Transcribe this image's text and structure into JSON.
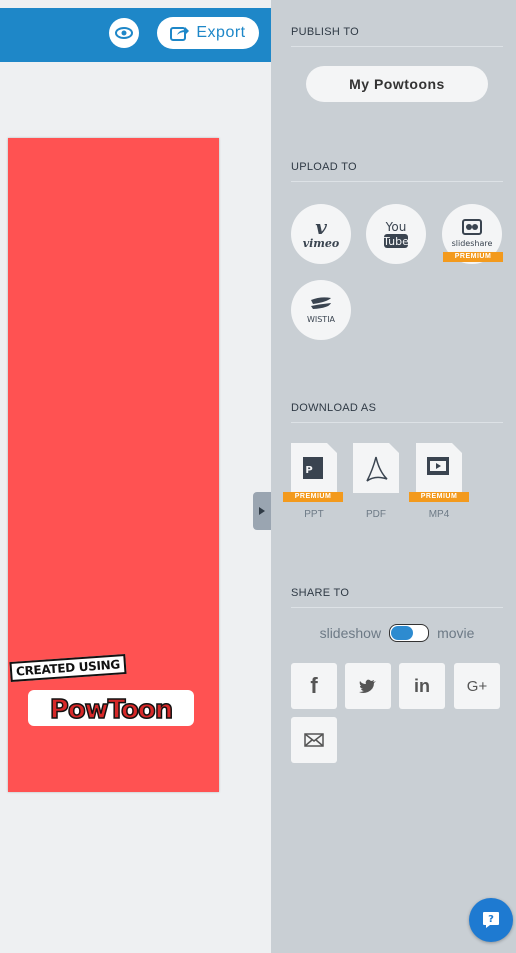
{
  "header": {
    "export_label": "Export"
  },
  "slide": {
    "background_color": "#ff5252",
    "watermark": {
      "tag_text": "CREATED USING",
      "logo_text": "PowToon"
    }
  },
  "panel": {
    "publish": {
      "title": "PUBLISH TO",
      "button_label": "My Powtoons"
    },
    "upload": {
      "title": "UPLOAD TO",
      "services": [
        {
          "name": "vimeo",
          "icon": "vimeo-icon",
          "text": "vimeo"
        },
        {
          "name": "youtube",
          "icon": "youtube-icon",
          "text_top": "You",
          "text_bottom": "Tube"
        },
        {
          "name": "slideshare",
          "icon": "slideshare-icon",
          "text": "slideshare",
          "badge": "PREMIUM"
        },
        {
          "name": "wistia",
          "icon": "wistia-icon",
          "text": "WISTIA"
        }
      ]
    },
    "download": {
      "title": "DOWNLOAD AS",
      "formats": [
        {
          "label": "PPT",
          "badge": "PREMIUM",
          "icon": "ppt-file-icon"
        },
        {
          "label": "PDF",
          "icon": "pdf-file-icon"
        },
        {
          "label": "MP4",
          "badge": "PREMIUM",
          "icon": "mp4-file-icon"
        }
      ]
    },
    "share": {
      "title": "SHARE TO",
      "toggle_left": "slideshow",
      "toggle_right": "movie",
      "networks": [
        {
          "name": "facebook",
          "icon": "facebook-icon",
          "glyph": "f"
        },
        {
          "name": "twitter",
          "icon": "twitter-icon"
        },
        {
          "name": "linkedin",
          "icon": "linkedin-icon",
          "glyph": "in"
        },
        {
          "name": "google-plus",
          "icon": "google-plus-icon",
          "glyph": "G+"
        },
        {
          "name": "email",
          "icon": "email-icon"
        }
      ]
    }
  },
  "colors": {
    "accent": "#1e87c8",
    "premium": "#f39a1d",
    "panel_bg": "#c9cfd4"
  }
}
